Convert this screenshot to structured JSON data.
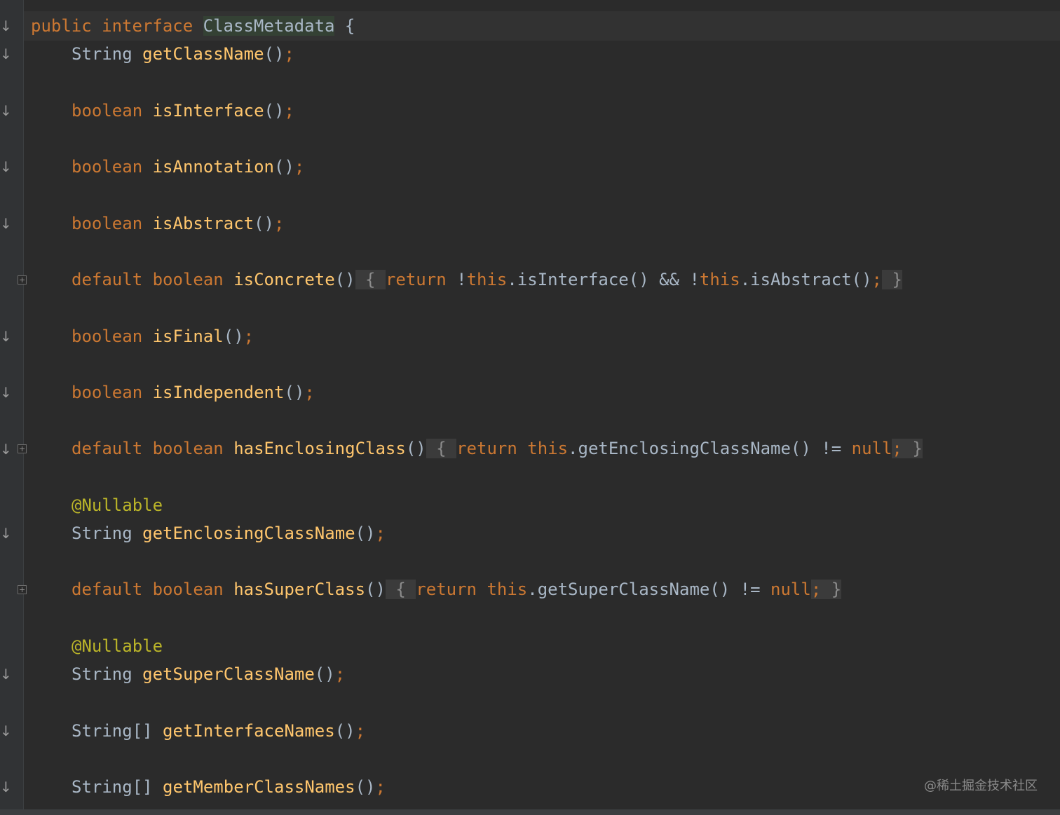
{
  "editor": {
    "language": "Java",
    "colors": {
      "background": "#2b2b2b",
      "keyword": "#cc7832",
      "method": "#ffc66d",
      "type": "#a9b7c6",
      "annotation": "#bbb529"
    }
  },
  "code": {
    "l1": {
      "kw": "public interface ",
      "cls": "ClassMetadata",
      "tail": " {"
    },
    "l2": {
      "type": "String ",
      "fn": "getClassName",
      "paren": "()",
      "semi": ";"
    },
    "l3": {
      "type": "boolean ",
      "fn": "isInterface",
      "paren": "()",
      "semi": ";"
    },
    "l4": {
      "type": "boolean ",
      "fn": "isAnnotation",
      "paren": "()",
      "semi": ";"
    },
    "l5": {
      "type": "boolean ",
      "fn": "isAbstract",
      "paren": "()",
      "semi": ";"
    },
    "l6": {
      "kw": "default boolean ",
      "fn": "isConcrete",
      "paren": "()",
      "open": " { ",
      "ret": "return ",
      "b1": "!",
      "this1": "this",
      "m1": ".isInterface() && ",
      "b2": "!",
      "this2": "this",
      "m2": ".isAbstract()",
      "semi": ";",
      "close": " }"
    },
    "l7": {
      "type": "boolean ",
      "fn": "isFinal",
      "paren": "()",
      "semi": ";"
    },
    "l8": {
      "type": "boolean ",
      "fn": "isIndependent",
      "paren": "()",
      "semi": ";"
    },
    "l9": {
      "kw": "default boolean ",
      "fn": "hasEnclosingClass",
      "paren": "()",
      "open": " { ",
      "ret": "return ",
      "this1": "this",
      "m1": ".getEnclosingClassName() != ",
      "nul": "null",
      "semi": ";",
      "close": " }"
    },
    "l10": {
      "ann": "@Nullable"
    },
    "l11": {
      "type": "String ",
      "fn": "getEnclosingClassName",
      "paren": "()",
      "semi": ";"
    },
    "l12": {
      "kw": "default boolean ",
      "fn": "hasSuperClass",
      "paren": "()",
      "open": " { ",
      "ret": "return ",
      "this1": "this",
      "m1": ".getSuperClassName() != ",
      "nul": "null",
      "semi": ";",
      "close": " }"
    },
    "l13": {
      "ann": "@Nullable"
    },
    "l14": {
      "type": "String ",
      "fn": "getSuperClassName",
      "paren": "()",
      "semi": ";"
    },
    "l15": {
      "type": "String[] ",
      "fn": "getInterfaceNames",
      "paren": "()",
      "semi": ";"
    },
    "l16": {
      "type": "String[] ",
      "fn": "getMemberClassNames",
      "paren": "()",
      "semi": ";"
    }
  },
  "gutter": {
    "impl_marker": "↓"
  },
  "watermark": "@稀土掘金技术社区"
}
